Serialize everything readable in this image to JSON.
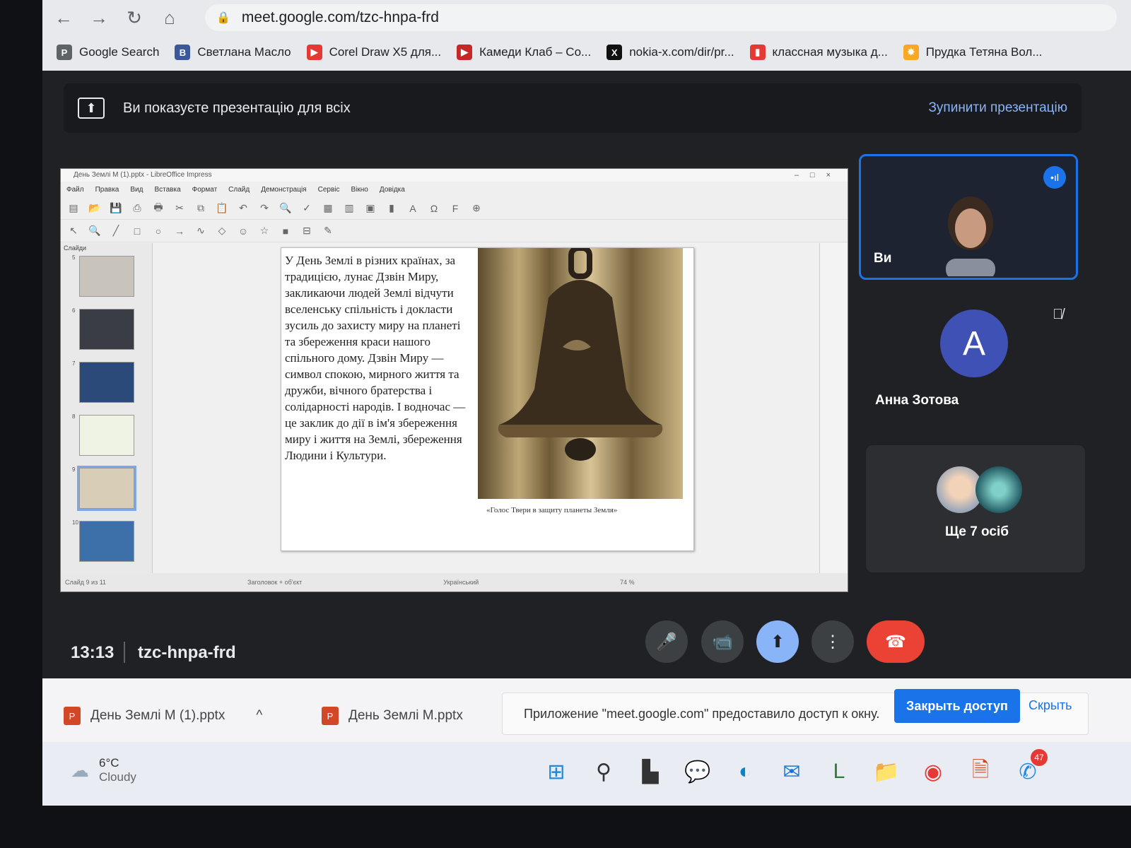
{
  "browser": {
    "url": "meet.google.com/tzc-hnpa-frd",
    "bookmarks": [
      {
        "label": "Google Search",
        "icon": "P",
        "color": "#5f6368"
      },
      {
        "label": "Светлана Масло",
        "icon": "B",
        "color": "#3b5998"
      },
      {
        "label": "Corel Draw X5 для...",
        "icon": "▶",
        "color": "#e53935"
      },
      {
        "label": "Камеди Клаб – Co...",
        "icon": "▶",
        "color": "#c62828"
      },
      {
        "label": "nokia-x.com/dir/pr...",
        "icon": "X",
        "color": "#111111"
      },
      {
        "label": "классная музыка д...",
        "icon": "▮",
        "color": "#e53935"
      },
      {
        "label": "Прудка Тетяна Вол...",
        "icon": "✸",
        "color": "#f9a825"
      }
    ]
  },
  "banner": {
    "text": "Ви показуєте презентацію для всіх",
    "stop_label": "Зупинити презентацію"
  },
  "presentation": {
    "window_title": "День Землі М (1).pptx - LibreOffice Impress",
    "menu": [
      "Файл",
      "Правка",
      "Вид",
      "Вставка",
      "Формат",
      "Слайд",
      "Демонстрація",
      "Сервіс",
      "Вікно",
      "Довідка"
    ],
    "slides_header": "Слайди",
    "thumb_numbers": [
      "5",
      "6",
      "7",
      "8",
      "9",
      "10"
    ],
    "slide_text": "У День Землі в різних країнах, за традицією, лунає Дзвін Миру, закликаючи людей Землі відчути вселенську спільність і докласти зусиль до захисту миру на планеті та збереження краси нашого спільного дому. Дзвін Миру — символ спокою, мирного життя та дружби, вічного братерства і солідарності народів. І водночас — це заклик до дії в ім'я збереження миру і життя на Землі, збереження Людини і Культури.",
    "bell_caption": "«Голос Твери в защиту планеты Земля»",
    "status_slide": "Слайд 9 из 11",
    "status_layout": "Заголовок + об'єкт",
    "status_lang": "Український",
    "status_zoom": "74 %"
  },
  "participants": {
    "you_label": "Ви",
    "anna_initial": "A",
    "anna_name": "Анна Зотова",
    "more_label": "Ще 7 осіб"
  },
  "meeting": {
    "time": "13:13",
    "code": "tzc-hnpa-frd"
  },
  "downloads": {
    "file1": "День Землі М (1).pptx",
    "file2": "День Землі М.pptx",
    "share_message": "Приложение \"meet.google.com\" предоставило доступ к окну.",
    "close_access": "Закрыть доступ",
    "hide": "Скрыть"
  },
  "taskbar": {
    "temperature": "6°C",
    "condition": "Cloudy",
    "notification_count": "47"
  },
  "colors": {
    "accent": "#1a73e8",
    "end_call": "#ea4335",
    "present_button": "#8ab4f8",
    "meet_bg": "#202124"
  }
}
